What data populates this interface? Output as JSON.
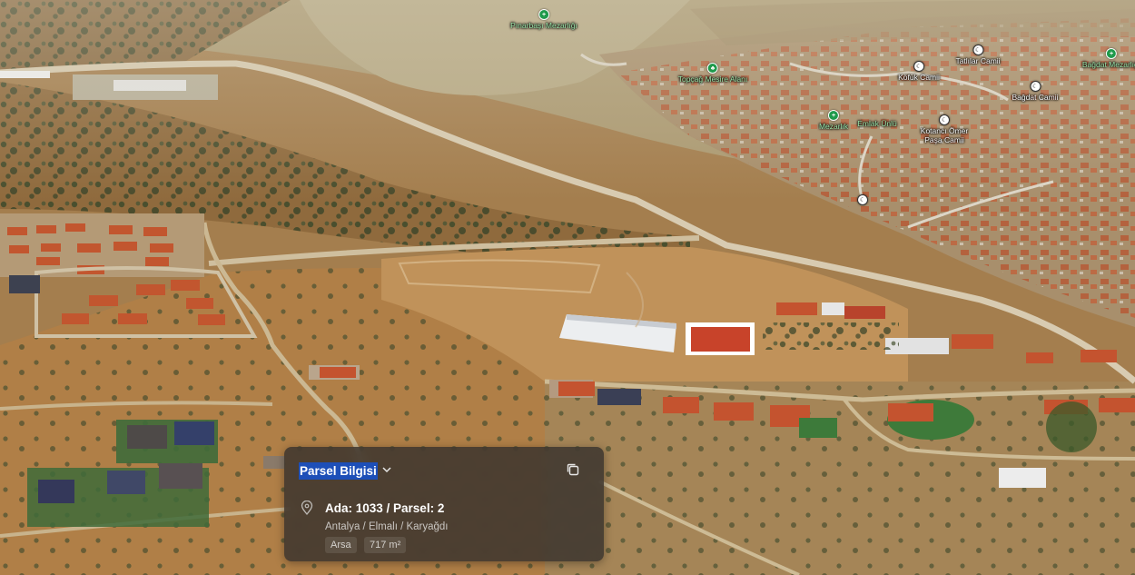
{
  "map": {
    "pois": [
      {
        "name": "Pınarbaşı Mezarlığı",
        "kind": "cemetery"
      },
      {
        "name": "Topçağ Mesire Alanı",
        "kind": "park"
      },
      {
        "name": "Mezarlık",
        "kind": "cemetery"
      },
      {
        "name": "Emlak Ünlü",
        "kind": "cemetery"
      },
      {
        "name": "Köfük Camii",
        "kind": "mosque"
      },
      {
        "name": "Tatlılar Camii",
        "kind": "mosque"
      },
      {
        "name": "Bağdat Camii",
        "kind": "mosque"
      },
      {
        "name": "Bağdat Mezarlığı",
        "kind": "cemetery"
      },
      {
        "name": "Kotancı Ömer Paşa Camii",
        "kind": "mosque"
      },
      {
        "name": "",
        "kind": "mosque"
      }
    ],
    "highlight_color": "#c8432a"
  },
  "panel": {
    "title": "Parsel Bilgisi",
    "parcel": "Ada: 1033 / Parsel: 2",
    "location": "Antalya / Elmalı / Karyağdı",
    "type": "Arsa",
    "area": "717 m²"
  }
}
